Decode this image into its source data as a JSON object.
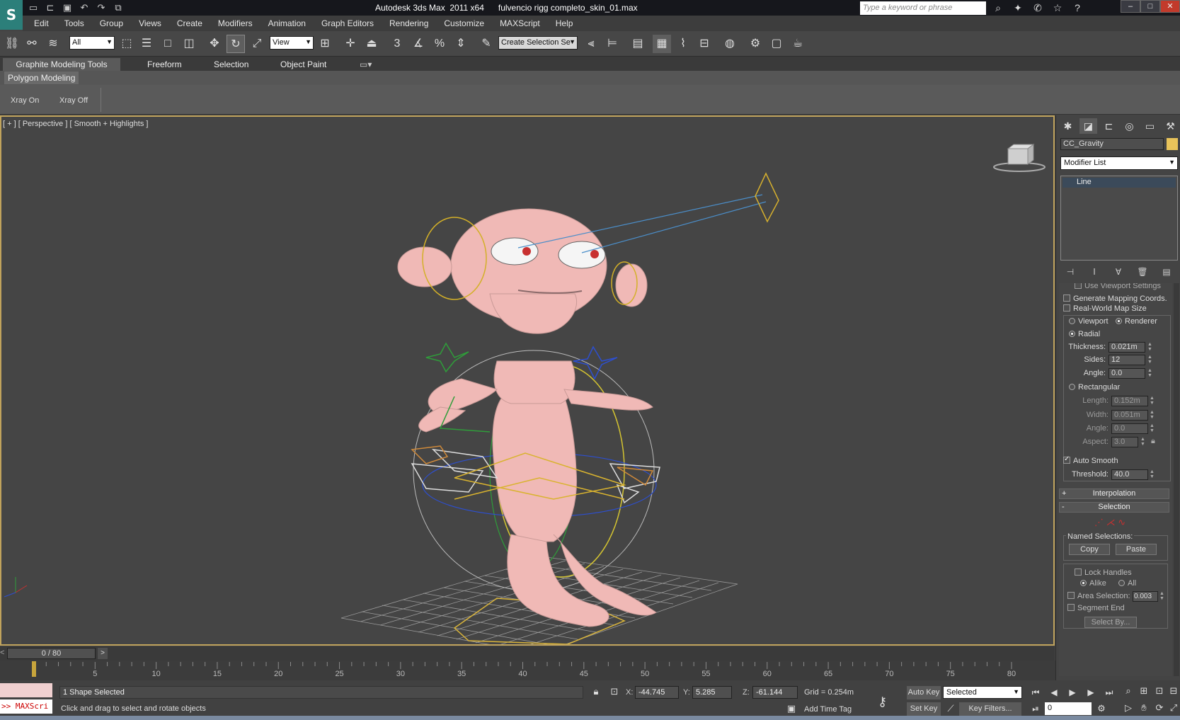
{
  "titlebar": {
    "title": "Autodesk 3ds Max  2011 x64      fulvencio rigg completo_skin_01.max",
    "search_placeholder": "Type a keyword or phrase",
    "window_buttons": [
      "–",
      "□",
      "✕"
    ]
  },
  "menu": [
    "Edit",
    "Tools",
    "Group",
    "Views",
    "Create",
    "Modifiers",
    "Animation",
    "Graph Editors",
    "Rendering",
    "Customize",
    "MAXScript",
    "Help"
  ],
  "toolbar": {
    "filter_value": "All",
    "coord_system": "View",
    "selection_set": "Create Selection Se"
  },
  "ribbon": {
    "tabs": [
      "Graphite Modeling Tools",
      "Freeform",
      "Selection",
      "Object Paint"
    ],
    "sub_tab": "Polygon Modeling",
    "buttons": [
      "Xray On",
      "Xray Off"
    ]
  },
  "viewport": {
    "label": "[ + ] [ Perspective ] [ Smooth + Highlights ]",
    "border_color": "#c0a35c"
  },
  "timeline": {
    "frame_display": "0 / 80",
    "current_frame": 0,
    "total_frames": 80,
    "ticks": [
      "0",
      "5",
      "10",
      "15",
      "20",
      "25",
      "30",
      "35",
      "40",
      "45",
      "50",
      "55",
      "60",
      "65",
      "70",
      "75",
      "80"
    ]
  },
  "status": {
    "maxscript": ">> MAXScri",
    "selection": "1 Shape Selected",
    "prompt": "Click and drag to select and rotate objects",
    "x_label": "X:",
    "x": "-44.745",
    "y_label": "Y:",
    "y": "5.285",
    "z_label": "Z:",
    "z": "-61.144",
    "grid": "Grid = 0.254m",
    "add_time_tag": "Add Time Tag",
    "auto_key": "Auto Key",
    "set_key": "Set Key",
    "key_mode": "Selected",
    "key_filters": "Key Filters...",
    "frame": "0"
  },
  "command_panel": {
    "object_name": "CC_Gravity",
    "object_color": "#e8c35a",
    "modifier_list": "Modifier List",
    "stack_item": "Line",
    "rendering": {
      "use_viewport_settings": "Use Viewport Settings",
      "generate_mapping": "Generate Mapping Coords.",
      "real_world": "Real-World Map Size",
      "viewport": "Viewport",
      "renderer": "Renderer",
      "radial": "Radial",
      "thickness_label": "Thickness:",
      "thickness": "0.021m",
      "sides_label": "Sides:",
      "sides": "12",
      "angle_label": "Angle:",
      "angle": "0.0",
      "rectangular": "Rectangular",
      "length_label": "Length:",
      "length": "0.152m",
      "width_label": "Width:",
      "width": "0.051m",
      "angle2_label": "Angle:",
      "angle2": "0.0",
      "aspect_label": "Aspect:",
      "aspect": "3.0",
      "auto_smooth": "Auto Smooth",
      "threshold_label": "Threshold:",
      "threshold": "40.0"
    },
    "interpolation": "Interpolation",
    "selection": {
      "title": "Selection",
      "named_selections": "Named Selections:",
      "copy": "Copy",
      "paste": "Paste",
      "lock_handles": "Lock Handles",
      "alike": "Alike",
      "all": "All",
      "area_selection": "Area Selection:",
      "area_value": "0.003",
      "segment_end": "Segment End",
      "select_by": "Select By..."
    }
  }
}
